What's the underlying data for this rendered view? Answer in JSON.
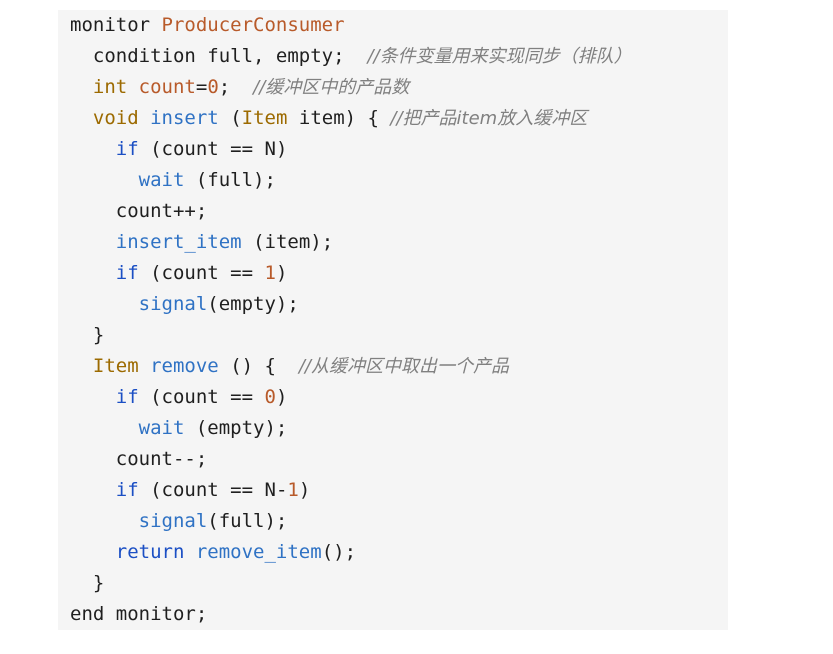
{
  "code": {
    "l1_kw": "monitor",
    "l1_name": "ProducerConsumer",
    "l2_kw": "condition",
    "l2_rest": "full, empty;",
    "l2_comment": "//条件变量用来实现同步（排队）",
    "l3_type": "int",
    "l3_var": "count",
    "l3_assign": "=",
    "l3_num": "0",
    "l3_semi": ";",
    "l3_comment": "//缓冲区中的产品数",
    "l4_type": "void",
    "l4_name": "insert",
    "l4_open": "(",
    "l4_ptype": "Item",
    "l4_rest": "item) {",
    "l4_comment": "//把产品item放入缓冲区",
    "l5_kw": "if",
    "l5_rest": "(count == N)",
    "l6_call": "wait",
    "l6_rest": "(full);",
    "l7_text": "count++;",
    "l8_call": "insert_item",
    "l8_rest": "(item);",
    "l9_kw": "if",
    "l9_a": "(count ==",
    "l9_num": "1",
    "l9_b": ")",
    "l10_call": "signal",
    "l10_rest": "(empty);",
    "l11_text": "}",
    "l12_type": "Item",
    "l12_name": "remove",
    "l12_rest": "() {",
    "l12_comment": "//从缓冲区中取出一个产品",
    "l13_kw": "if",
    "l13_a": "(count ==",
    "l13_num": "0",
    "l13_b": ")",
    "l14_call": "wait",
    "l14_rest": "(empty);",
    "l15_text": "count--;",
    "l16_kw": "if",
    "l16_a": "(count == N-",
    "l16_num": "1",
    "l16_b": ")",
    "l17_call": "signal",
    "l17_rest": "(full);",
    "l18_kw": "return",
    "l18_call": "remove_item",
    "l18_rest": "();",
    "l19_text": "}",
    "l20_text": "end monitor;"
  }
}
